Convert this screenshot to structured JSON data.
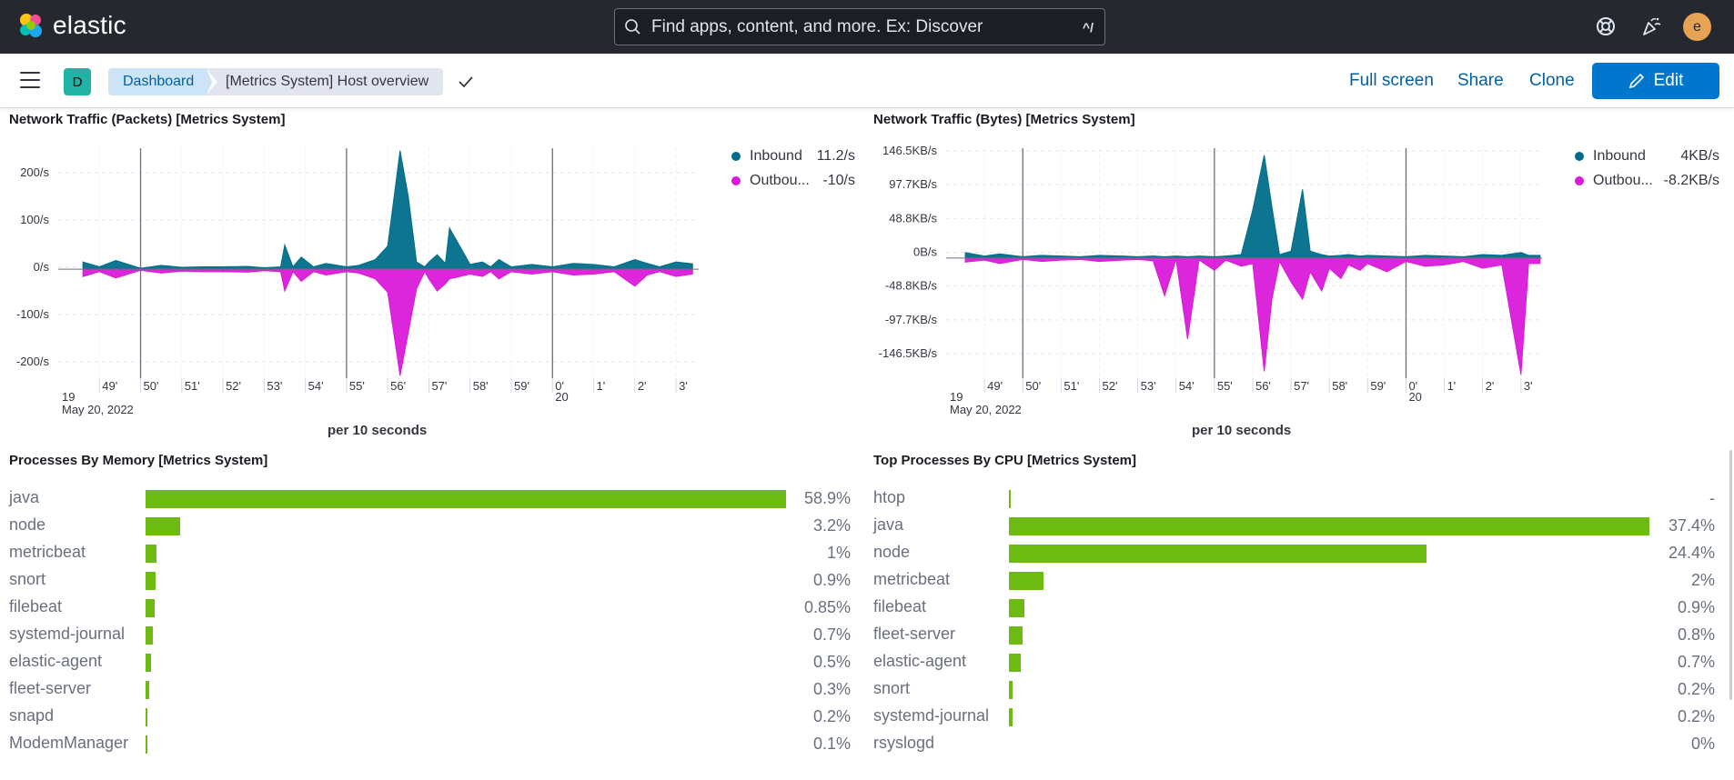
{
  "header": {
    "brand": "elastic",
    "search_placeholder": "Find apps, content, and more. Ex: Discover",
    "search_shortcut": "^/",
    "user_initial": "e"
  },
  "subnav": {
    "space_initial": "D",
    "breadcrumbs": [
      "Dashboard",
      "[Metrics System] Host overview"
    ],
    "actions": {
      "full_screen": "Full screen",
      "share": "Share",
      "clone": "Clone",
      "edit": "Edit"
    }
  },
  "colors": {
    "inbound": "#006e8a",
    "outbound": "#d91ad9",
    "bar": "#6dba13",
    "link": "#0061a6"
  },
  "icons": [
    "elastic-logo-icon",
    "search-icon",
    "help-icon",
    "newsfeed-icon",
    "menu-icon",
    "check-icon",
    "pencil-icon"
  ],
  "charts": {
    "packets": {
      "title": "Network Traffic (Packets) [Metrics System]",
      "x_label": "per 10 seconds",
      "legend": [
        {
          "name": "Inbound",
          "value": "11.2/s"
        },
        {
          "name": "Outbou...",
          "value": "-10/s"
        }
      ]
    },
    "bytes": {
      "title": "Network Traffic (Bytes) [Metrics System]",
      "x_label": "per 10 seconds",
      "legend": [
        {
          "name": "Inbound",
          "value": "4KB/s"
        },
        {
          "name": "Outbou...",
          "value": "-8.2KB/s"
        }
      ]
    },
    "memory": {
      "title": "Processes By Memory [Metrics System]",
      "rows": [
        {
          "name": "java",
          "label": "58.9%",
          "value": 58.9
        },
        {
          "name": "node",
          "label": "3.2%",
          "value": 3.2
        },
        {
          "name": "metricbeat",
          "label": "1%",
          "value": 1
        },
        {
          "name": "snort",
          "label": "0.9%",
          "value": 0.9
        },
        {
          "name": "filebeat",
          "label": "0.85%",
          "value": 0.85
        },
        {
          "name": "systemd-journal",
          "label": "0.7%",
          "value": 0.7
        },
        {
          "name": "elastic-agent",
          "label": "0.5%",
          "value": 0.5
        },
        {
          "name": "fleet-server",
          "label": "0.3%",
          "value": 0.3
        },
        {
          "name": "snapd",
          "label": "0.2%",
          "value": 0.2
        },
        {
          "name": "ModemManager",
          "label": "0.1%",
          "value": 0.1
        }
      ]
    },
    "cpu": {
      "title": "Top Processes By CPU [Metrics System]",
      "rows": [
        {
          "name": "htop",
          "label": "-",
          "value": 0.1
        },
        {
          "name": "java",
          "label": "37.4%",
          "value": 37.4
        },
        {
          "name": "node",
          "label": "24.4%",
          "value": 24.4
        },
        {
          "name": "metricbeat",
          "label": "2%",
          "value": 2
        },
        {
          "name": "filebeat",
          "label": "0.9%",
          "value": 0.9
        },
        {
          "name": "fleet-server",
          "label": "0.8%",
          "value": 0.8
        },
        {
          "name": "elastic-agent",
          "label": "0.7%",
          "value": 0.7
        },
        {
          "name": "snort",
          "label": "0.2%",
          "value": 0.2
        },
        {
          "name": "systemd-journal",
          "label": "0.2%",
          "value": 0.2
        },
        {
          "name": "rsyslogd",
          "label": "0%",
          "value": 0
        }
      ]
    }
  },
  "chart_data": [
    {
      "type": "area",
      "title": "Network Traffic (Packets) [Metrics System]",
      "xlabel": "per 10 seconds",
      "x_ticks": [
        "49'",
        "50'",
        "51'",
        "52'",
        "53'",
        "54'",
        "55'",
        "56'",
        "57'",
        "58'",
        "59'",
        "0'",
        "1'",
        "2'",
        "3'"
      ],
      "x_major_labels": [
        "19",
        "20"
      ],
      "x_date_label": "May 20, 2022",
      "y_ticks": [
        "200/s",
        "100/s",
        "0/s",
        "-100/s",
        "-200/s"
      ],
      "ylim": [
        -225,
        250
      ],
      "x_minutes": [
        -11.4,
        -11,
        -10.6,
        -10,
        -9.5,
        -9,
        -8.5,
        -8,
        -7.4,
        -7,
        -6.6,
        -6.5,
        -6.3,
        -6.1,
        -5.8,
        -5.5,
        -5,
        -4.7,
        -4.3,
        -4,
        -3.7,
        -3.5,
        -3.3,
        -3.1,
        -3,
        -2.8,
        -2.6,
        -2.5,
        -2,
        -1.7,
        -1.5,
        -1.3,
        -1,
        -0.5,
        0,
        0.5,
        1,
        1.5,
        2,
        2.3,
        2.6,
        3,
        3.4
      ],
      "series": [
        {
          "name": "Inbound",
          "values": [
            15,
            5,
            18,
            2,
            8,
            4,
            5,
            5,
            6,
            3,
            5,
            50,
            5,
            25,
            5,
            12,
            5,
            8,
            20,
            48,
            245,
            150,
            15,
            5,
            15,
            30,
            12,
            85,
            10,
            15,
            5,
            20,
            5,
            10,
            5,
            12,
            10,
            5,
            20,
            12,
            5,
            15,
            11.2
          ]
        },
        {
          "name": "Outbound",
          "values": [
            -15,
            -5,
            -18,
            -2,
            -8,
            -4,
            -5,
            -5,
            -6,
            -3,
            -5,
            -45,
            -5,
            -25,
            -5,
            -12,
            -5,
            -8,
            -20,
            -48,
            -220,
            -130,
            -40,
            -5,
            -20,
            -45,
            -30,
            -20,
            -10,
            -15,
            -5,
            -20,
            -5,
            -10,
            -5,
            -12,
            -10,
            -5,
            -35,
            -12,
            -5,
            -15,
            -10
          ]
        }
      ]
    },
    {
      "type": "area",
      "title": "Network Traffic (Bytes) [Metrics System]",
      "xlabel": "per 10 seconds",
      "x_ticks": [
        "49'",
        "50'",
        "51'",
        "52'",
        "53'",
        "54'",
        "55'",
        "56'",
        "57'",
        "58'",
        "59'",
        "0'",
        "1'",
        "2'",
        "3'"
      ],
      "x_major_labels": [
        "19",
        "20"
      ],
      "x_date_label": "May 20, 2022",
      "y_ticks": [
        "146.5KB/s",
        "97.7KB/s",
        "48.8KB/s",
        "0B/s",
        "-48.8KB/s",
        "-97.7KB/s",
        "-146.5KB/s"
      ],
      "ylim": [
        -175,
        160
      ],
      "x_minutes": [
        -11.5,
        -11,
        -10.6,
        -10,
        -9.5,
        -9,
        -8.5,
        -8,
        -7.4,
        -7,
        -6.6,
        -6.3,
        -6,
        -5.7,
        -5.4,
        -5,
        -4.7,
        -4.3,
        -4,
        -3.7,
        -3.5,
        -3.3,
        -3,
        -2.7,
        -2.5,
        -2.2,
        -2,
        -1.7,
        -1.5,
        -1.2,
        -1,
        -0.5,
        0,
        0.5,
        1,
        1.5,
        2,
        2.5,
        3,
        3.2,
        3.5
      ],
      "series": [
        {
          "name": "Inbound",
          "values": [
            8,
            3,
            6,
            2,
            4,
            3,
            2,
            4,
            3,
            2,
            3,
            2,
            3,
            2,
            3,
            2,
            3,
            5,
            70,
            150,
            75,
            5,
            10,
            100,
            10,
            5,
            3,
            4,
            5,
            3,
            4,
            3,
            2,
            4,
            3,
            2,
            5,
            4,
            8,
            4,
            4
          ]
        },
        {
          "name": "Outbound",
          "values": [
            -6,
            -3,
            -8,
            -2,
            -5,
            -3,
            -2,
            -5,
            -3,
            -2,
            -4,
            -55,
            -2,
            -118,
            -3,
            -18,
            -3,
            -12,
            -8,
            -165,
            -60,
            -5,
            -35,
            -60,
            -20,
            -48,
            -15,
            -30,
            -10,
            -18,
            -8,
            -20,
            -5,
            -12,
            -10,
            -5,
            -15,
            -10,
            -170,
            -8,
            -8
          ]
        }
      ]
    },
    {
      "type": "bar",
      "title": "Processes By Memory [Metrics System]",
      "categories": [
        "java",
        "node",
        "metricbeat",
        "snort",
        "filebeat",
        "systemd-journal",
        "elastic-agent",
        "fleet-server",
        "snapd",
        "ModemManager"
      ],
      "values": [
        58.9,
        3.2,
        1,
        0.9,
        0.85,
        0.7,
        0.5,
        0.3,
        0.2,
        0.1
      ]
    },
    {
      "type": "bar",
      "title": "Top Processes By CPU [Metrics System]",
      "categories": [
        "htop",
        "java",
        "node",
        "metricbeat",
        "filebeat",
        "fleet-server",
        "elastic-agent",
        "snort",
        "systemd-journal",
        "rsyslogd"
      ],
      "values": [
        null,
        37.4,
        24.4,
        2,
        0.9,
        0.8,
        0.7,
        0.2,
        0.2,
        0
      ]
    }
  ]
}
